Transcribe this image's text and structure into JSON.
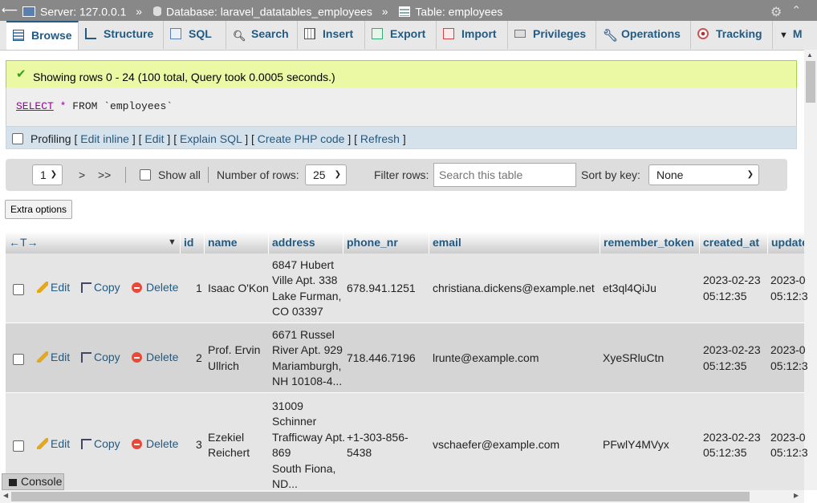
{
  "topbar": {
    "server": "Server: 127.0.0.1",
    "database": "Database: laravel_datatables_employees",
    "table": "Table: employees",
    "sep": "»"
  },
  "tabs": [
    {
      "label": "Browse",
      "icon": "browse-icon"
    },
    {
      "label": "Structure",
      "icon": "structure-icon"
    },
    {
      "label": "SQL",
      "icon": "sql-icon"
    },
    {
      "label": "Search",
      "icon": "search-icon"
    },
    {
      "label": "Insert",
      "icon": "insert-icon"
    },
    {
      "label": "Export",
      "icon": "export-icon"
    },
    {
      "label": "Import",
      "icon": "import-icon"
    },
    {
      "label": "Privileges",
      "icon": "privileges-icon"
    },
    {
      "label": "Operations",
      "icon": "operations-icon"
    },
    {
      "label": "Tracking",
      "icon": "tracking-icon"
    },
    {
      "label": "M",
      "icon": "chevron-down-icon"
    }
  ],
  "success": {
    "message": "Showing rows 0 - 24 (100 total, Query took 0.0005 seconds.)"
  },
  "sql": {
    "select": "SELECT",
    "star": "*",
    "rest": " FROM `employees`"
  },
  "profiling": {
    "label": "Profiling",
    "links": [
      "Edit inline",
      "Edit",
      "Explain SQL",
      "Create PHP code",
      "Refresh"
    ]
  },
  "nav": {
    "page": "1",
    "next": ">",
    "last": ">>",
    "show_all": "Show all",
    "rows_label": "Number of rows:",
    "rows_value": "25",
    "filter_label": "Filter rows:",
    "filter_placeholder": "Search this table",
    "sort_label": "Sort by key:",
    "sort_value": "None"
  },
  "extra_options": "Extra options",
  "table": {
    "arrows": "←T→",
    "columns": [
      "id",
      "name",
      "address",
      "phone_nr",
      "email",
      "remember_token",
      "created_at",
      "update"
    ],
    "actions": {
      "edit": "Edit",
      "copy": "Copy",
      "delete": "Delete"
    },
    "rows": [
      {
        "id": "1",
        "name": [
          "Isaac O'Kon"
        ],
        "address": [
          "6847 Hubert",
          "Ville Apt. 338",
          "Lake Furman,",
          "CO 03397"
        ],
        "phone": [
          "678.941.1251"
        ],
        "email": "christiana.dickens@example.net",
        "token": "et3ql4QiJu",
        "created": [
          "2023-02-23",
          "05:12:35"
        ],
        "updated": [
          "2023-0",
          "05:12:3"
        ]
      },
      {
        "id": "2",
        "name": [
          "Prof. Ervin",
          "Ullrich"
        ],
        "address": [
          "6671 Russel",
          "River Apt. 929",
          "Mariamburgh,",
          "NH 10108-4..."
        ],
        "phone": [
          "718.446.7196"
        ],
        "email": "lrunte@example.com",
        "token": "XyeSRluCtn",
        "created": [
          "2023-02-23",
          "05:12:35"
        ],
        "updated": [
          "2023-0",
          "05:12:3"
        ]
      },
      {
        "id": "3",
        "name": [
          "Ezekiel",
          "Reichert"
        ],
        "address": [
          "31009",
          "Schinner",
          "Trafficway Apt.",
          "869",
          "South Fiona,",
          "ND..."
        ],
        "phone": [
          "+1-303-856-",
          "5438"
        ],
        "email": "vschaefer@example.com",
        "token": "PFwlY4MVyx",
        "created": [
          "2023-02-23",
          "05:12:35"
        ],
        "updated": [
          "2023-0",
          "05:12:3"
        ]
      }
    ]
  },
  "console": "Console"
}
